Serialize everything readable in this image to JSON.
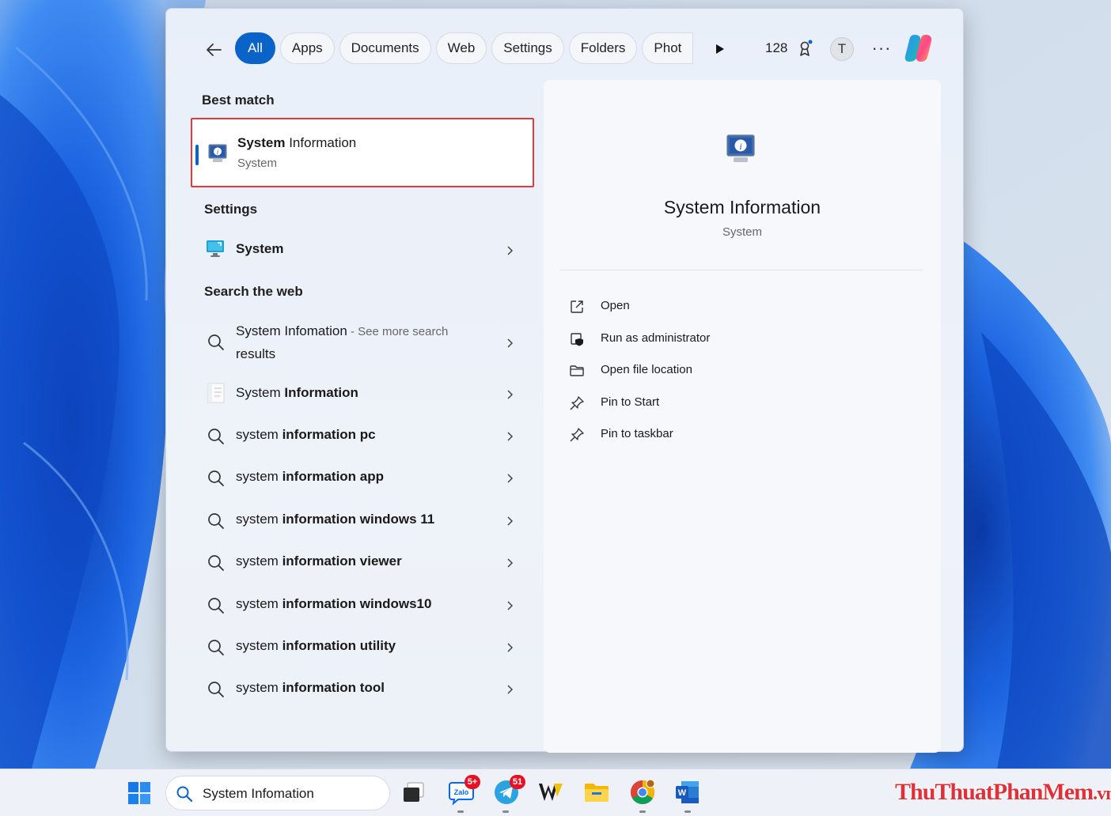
{
  "filters": {
    "tabs": [
      "All",
      "Apps",
      "Documents",
      "Web",
      "Settings",
      "Folders",
      "Phot"
    ],
    "active_index": 0
  },
  "header": {
    "points": "128",
    "avatar_letter": "T",
    "more_label": "···"
  },
  "sections": {
    "best_match": "Best match",
    "settings": "Settings",
    "search_web": "Search the web"
  },
  "best_match": {
    "title_bold": "System",
    "title_rest": " Information",
    "subtitle": "System"
  },
  "settings_item": {
    "label": "System"
  },
  "web_results": {
    "first": {
      "main": "System Infomation",
      "suffix": " - See more search",
      "suffix_line2": "results"
    },
    "app_item": {
      "prefix": "System ",
      "bold": "Information"
    },
    "items": [
      {
        "prefix": "system ",
        "bold": "information pc"
      },
      {
        "prefix": "system ",
        "bold": "information app"
      },
      {
        "prefix": "system ",
        "bold": "information windows 11"
      },
      {
        "prefix": "system ",
        "bold": "information viewer"
      },
      {
        "prefix": "system ",
        "bold": "information windows10"
      },
      {
        "prefix": "system ",
        "bold": "information utility"
      },
      {
        "prefix": "system ",
        "bold": "information tool"
      }
    ]
  },
  "preview": {
    "title": "System Information",
    "subtitle": "System",
    "actions": [
      "Open",
      "Run as administrator",
      "Open file location",
      "Pin to Start",
      "Pin to taskbar"
    ]
  },
  "taskbar": {
    "search_text": "System Infomation",
    "zalo_badge": "5+",
    "telegram_badge": "51"
  },
  "watermark": {
    "name": "ThuThuatPhanMem",
    "tld": ".vn"
  },
  "colors": {
    "accent": "#0a63c9",
    "highlight_border": "#e53a3a"
  }
}
